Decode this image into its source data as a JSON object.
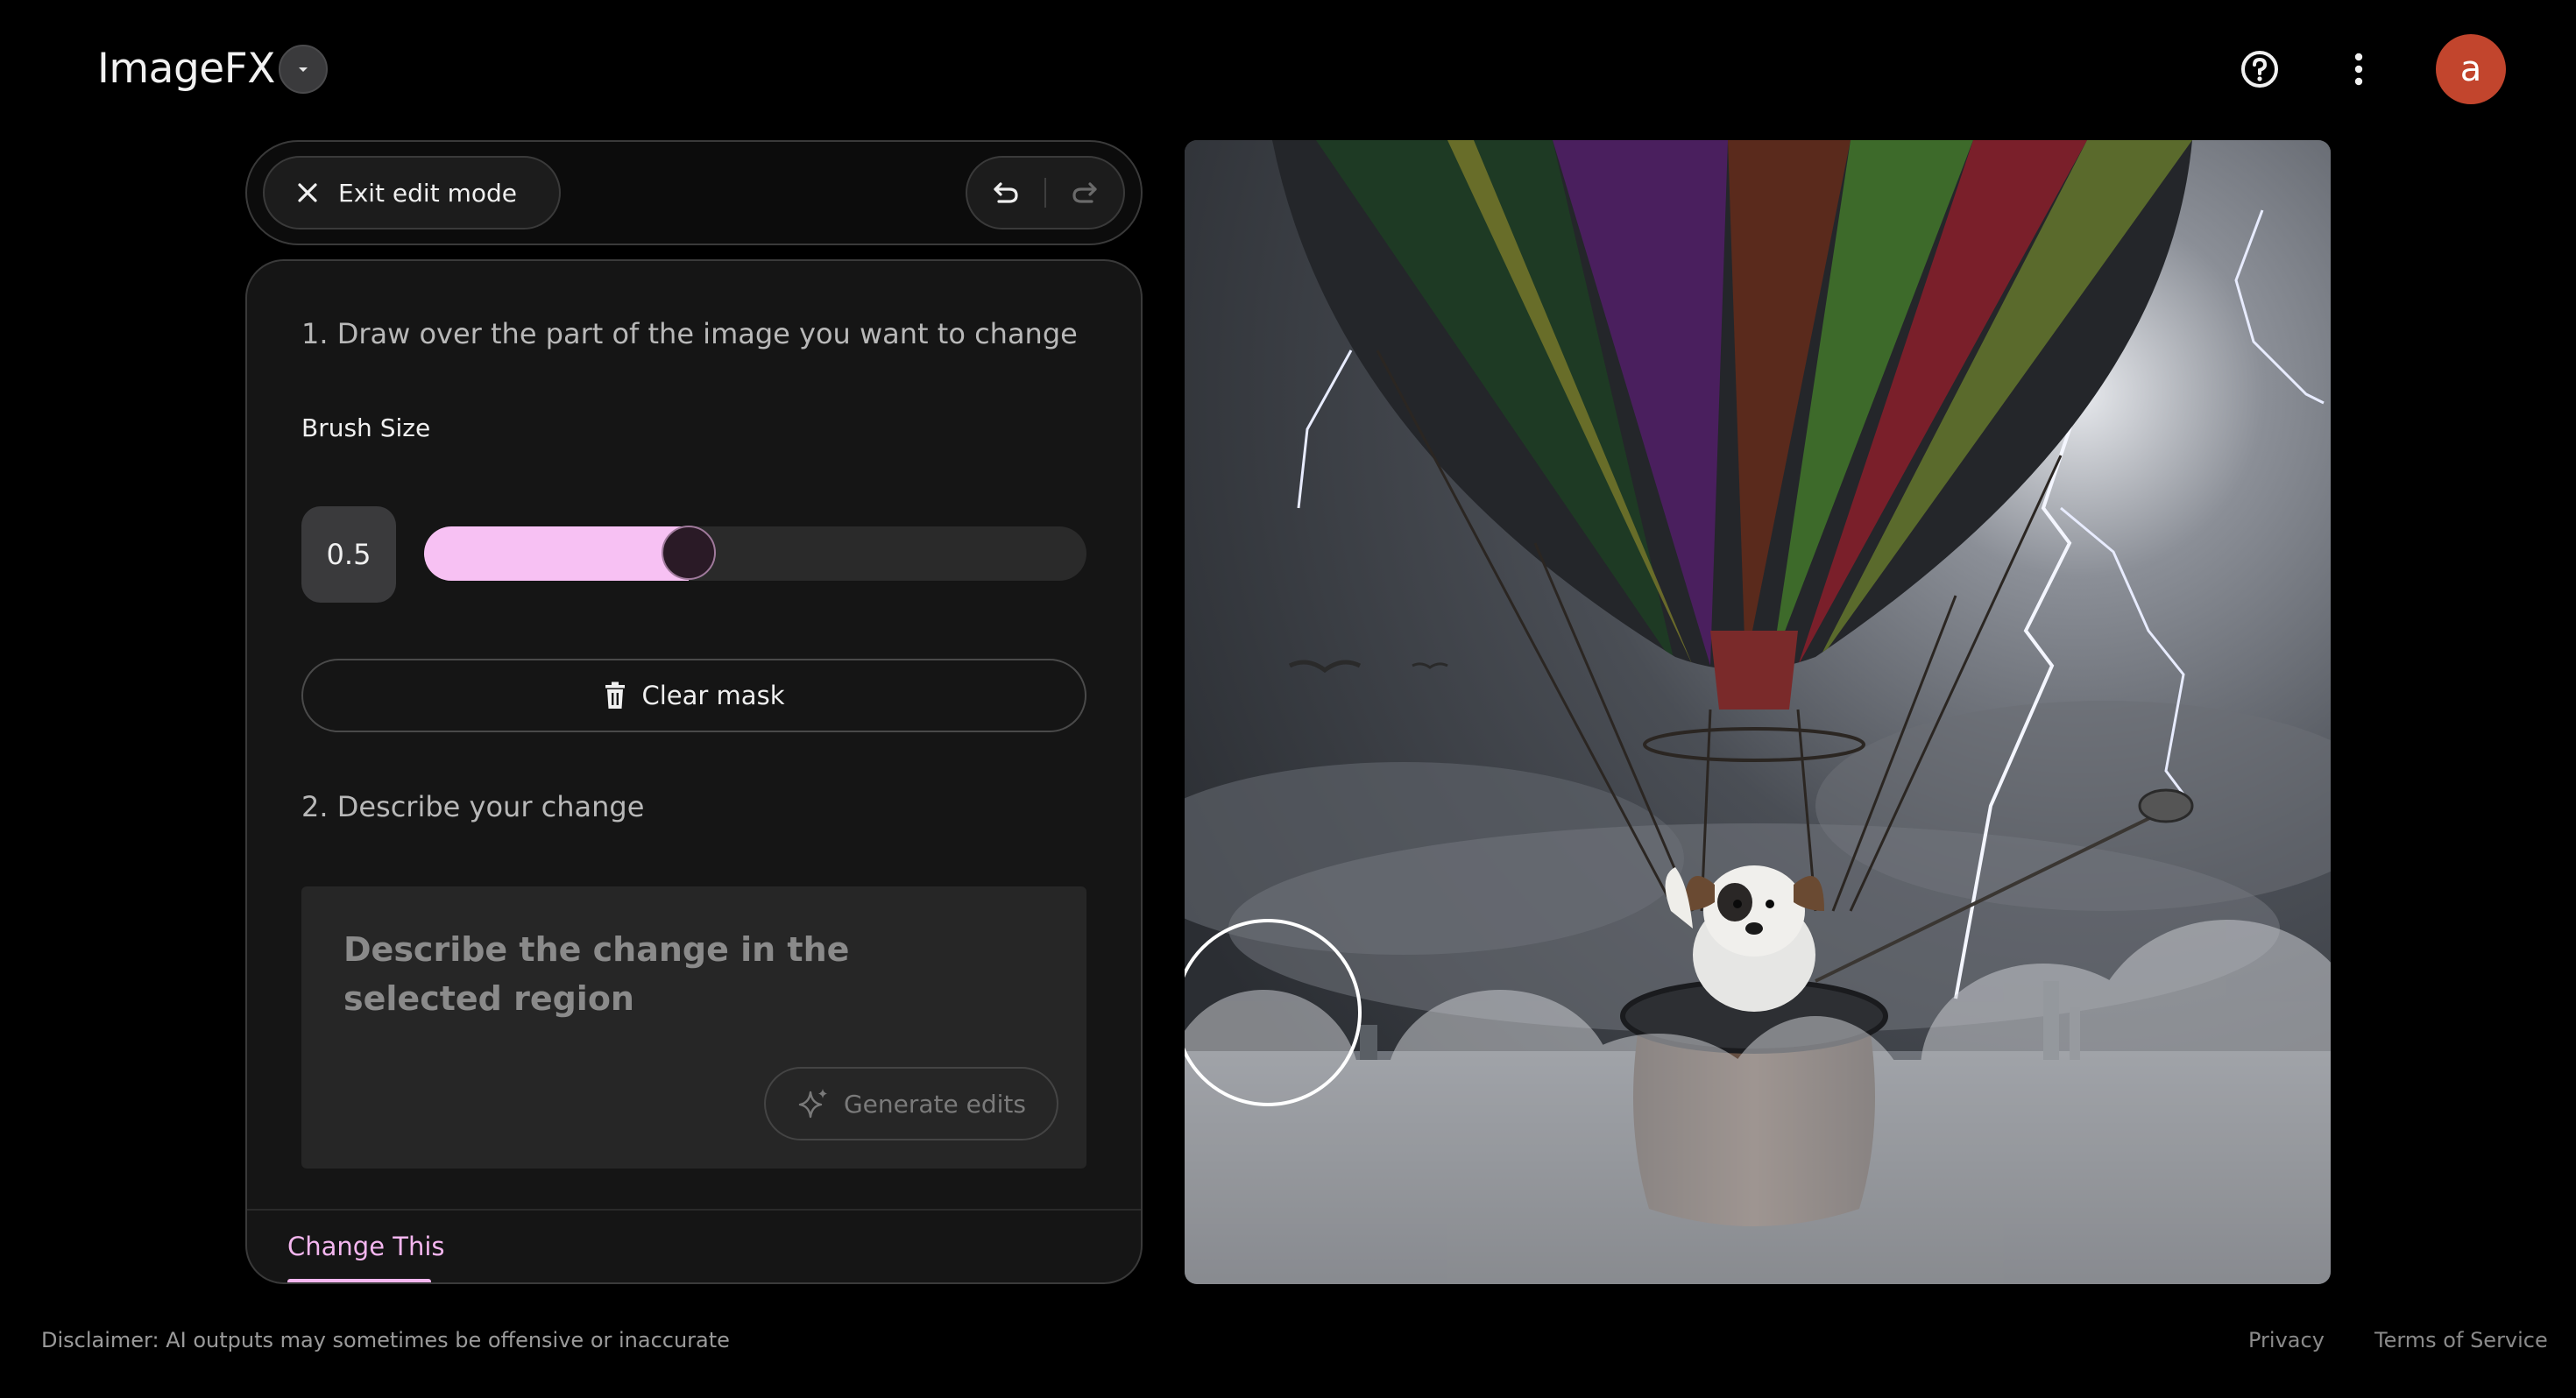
{
  "app": {
    "title": "ImageFX",
    "avatar_letter": "a",
    "avatar_color": "#c2452d",
    "accent": "#f7c1f3"
  },
  "header": {
    "dropdown_icon": "caret-down-icon",
    "help_icon": "help-circle-icon",
    "more_icon": "more-vert-icon"
  },
  "edit_bar": {
    "exit_label": "Exit edit mode",
    "exit_icon": "close-icon",
    "undo_icon": "undo-icon",
    "redo_icon": "redo-icon"
  },
  "panel": {
    "step1": "1. Draw over the part of the image you want to change",
    "brush_label": "Brush Size",
    "brush_value": "0.5",
    "brush_fraction": 0.4,
    "clear_mask_label": "Clear mask",
    "clear_icon": "trash-icon",
    "step2": "2. Describe your change",
    "prompt_placeholder": "Describe the change in the selected region",
    "generate_label": "Generate edits",
    "generate_icon": "sparkle-icon",
    "tab_label": "Change This"
  },
  "footer": {
    "disclaimer": "Disclaimer: AI outputs may sometimes be offensive or inaccurate",
    "privacy": "Privacy",
    "terms": "Terms of Service"
  }
}
